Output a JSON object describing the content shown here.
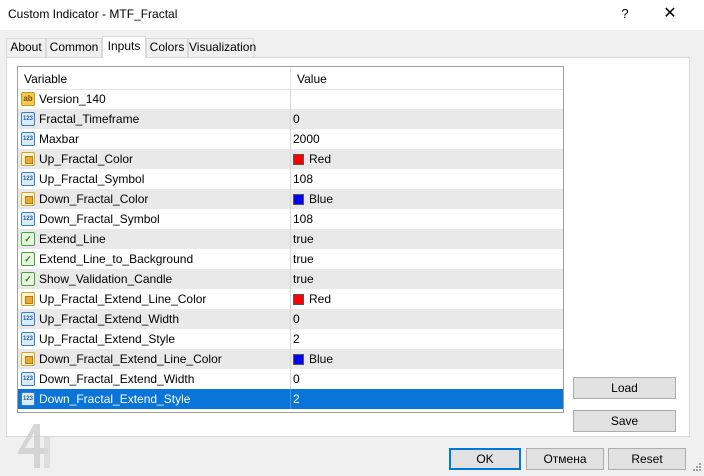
{
  "window": {
    "title": "Custom Indicator - MTF_Fractal",
    "help_glyph": "?",
    "close_glyph": "✕"
  },
  "tabs": [
    {
      "label": "About"
    },
    {
      "label": "Common"
    },
    {
      "label": "Inputs"
    },
    {
      "label": "Colors"
    },
    {
      "label": "Visualization"
    }
  ],
  "active_tab": "Inputs",
  "grid": {
    "headers": {
      "variable": "Variable",
      "value": "Value"
    },
    "rows": [
      {
        "name": "Version_140",
        "value": "",
        "icon": "string-icon"
      },
      {
        "name": "Fractal_Timeframe",
        "value": "0",
        "icon": "number-icon"
      },
      {
        "name": "Maxbar",
        "value": "2000",
        "icon": "number-icon"
      },
      {
        "name": "Up_Fractal_Color",
        "value": "Red",
        "icon": "color-icon",
        "swatch": "#ff0000"
      },
      {
        "name": "Up_Fractal_Symbol",
        "value": "108",
        "icon": "number-icon"
      },
      {
        "name": "Down_Fractal_Color",
        "value": "Blue",
        "icon": "color-icon",
        "swatch": "#0000ff"
      },
      {
        "name": "Down_Fractal_Symbol",
        "value": "108",
        "icon": "number-icon"
      },
      {
        "name": "Extend_Line",
        "value": "true",
        "icon": "bool-icon"
      },
      {
        "name": "Extend_Line_to_Background",
        "value": "true",
        "icon": "bool-icon"
      },
      {
        "name": "Show_Validation_Candle",
        "value": "true",
        "icon": "bool-icon"
      },
      {
        "name": "Up_Fractal_Extend_Line_Color",
        "value": "Red",
        "icon": "color-icon",
        "swatch": "#ff0000"
      },
      {
        "name": "Up_Fractal_Extend_Width",
        "value": "0",
        "icon": "number-icon"
      },
      {
        "name": "Up_Fractal_Extend_Style",
        "value": "2",
        "icon": "number-icon"
      },
      {
        "name": "Down_Fractal_Extend_Line_Color",
        "value": "Blue",
        "icon": "color-icon",
        "swatch": "#0000ff"
      },
      {
        "name": "Down_Fractal_Extend_Width",
        "value": "0",
        "icon": "number-icon"
      },
      {
        "name": "Down_Fractal_Extend_Style",
        "value": "2",
        "icon": "number-icon",
        "selected": true
      }
    ]
  },
  "icon_glyphs": {
    "string-icon": "ab",
    "number-icon": "123",
    "bool-icon": "✓"
  },
  "side_buttons": {
    "load": "Load",
    "save": "Save"
  },
  "footer_buttons": {
    "ok": "OK",
    "cancel": "Отмена",
    "reset": "Reset"
  },
  "colors": {
    "selection": "#0a75d9",
    "alt_row": "#e9e9e9"
  }
}
